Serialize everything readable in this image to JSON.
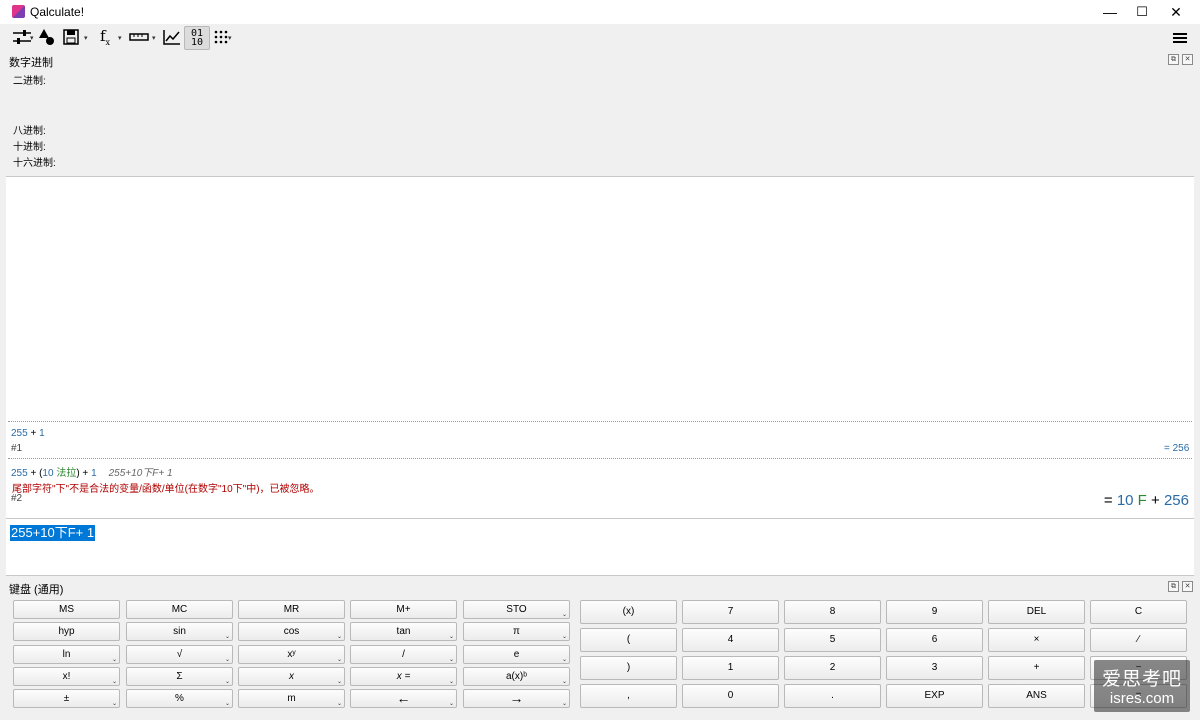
{
  "window": {
    "title": "Qalculate!",
    "minimize": "—",
    "maximize": "☐",
    "close": "✕"
  },
  "bases": {
    "title": "数字进制",
    "binary": "二进制:",
    "octal": "八进制:",
    "decimal": "十进制:",
    "hex": "十六进制:"
  },
  "history": {
    "entry1": {
      "n1": "255",
      "op1": " + ",
      "n2": "1",
      "ref": "#1",
      "result": "= 256"
    },
    "entry2": {
      "n1": "255",
      "op1": " + (",
      "n2": "10",
      "unit": " 法拉",
      "op2": ") + ",
      "n3": "1",
      "raw": "255+10下F+ 1",
      "error": "尾部字符\"下\"不是合法的变量/函数/单位(在数字\"10下\"中)，已被忽略。",
      "ref": "#2",
      "result_eq": "= ",
      "result_n1": "10",
      "result_unit": " F",
      "result_op": " + ",
      "result_n2": "256"
    }
  },
  "input": {
    "text": "255+10下F+ 1"
  },
  "keypad": {
    "title": "键盘 (通用)",
    "left_rows": [
      [
        "MS",
        "MC",
        "MR",
        "M+",
        "STO"
      ],
      [
        "hyp",
        "sin",
        "cos",
        "tan",
        "π"
      ],
      [
        "ln",
        "√",
        "xʸ",
        "/",
        "e"
      ],
      [
        "x!",
        "Σ",
        "x",
        "x =",
        "a(x)ᵇ"
      ],
      [
        "±",
        "%",
        "m",
        "←",
        "→"
      ]
    ],
    "right_rows": [
      [
        "(x)",
        "7",
        "8",
        "9",
        "DEL",
        "C"
      ],
      [
        "(",
        "4",
        "5",
        "6",
        "×",
        "∕"
      ],
      [
        ")",
        "1",
        "2",
        "3",
        "+",
        "−"
      ],
      [
        ",",
        "0",
        ".",
        "EXP",
        "ANS",
        "="
      ]
    ]
  },
  "watermark": {
    "line1": "爱思考吧",
    "line2": "isres.com"
  }
}
